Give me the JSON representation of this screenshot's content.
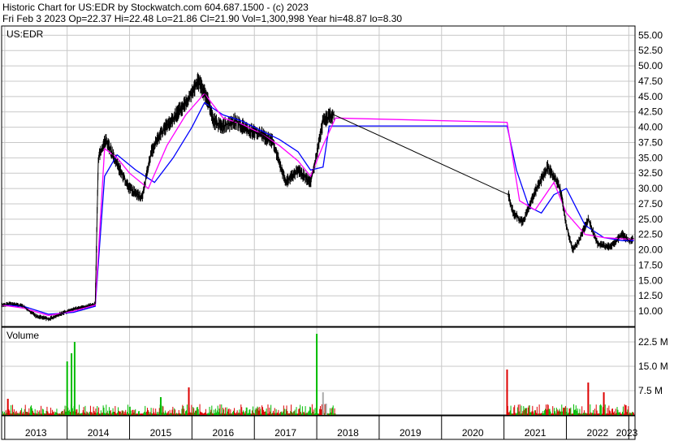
{
  "header": {
    "line1": "Historic Chart for US:EDR by Stockwatch.com 604.687.1500 - (c) 2023",
    "line2": "Fri Feb  3 2023   Op=22.37   Hi=22.48   Lo=21.86   Cl=21.90   Vol=1,300,998   Year hi=48.87   lo=8.30"
  },
  "chart_data": [
    {
      "type": "line",
      "panel": "price",
      "symbol_label": "US:EDR",
      "ylim": [
        7.5,
        56.5
      ],
      "y_ticks": [
        "10.00",
        "12.50",
        "15.00",
        "17.50",
        "20.00",
        "22.50",
        "25.00",
        "27.50",
        "30.00",
        "32.50",
        "35.00",
        "37.50",
        "40.00",
        "42.50",
        "45.00",
        "47.50",
        "50.00",
        "52.50",
        "55.00"
      ],
      "xlim": [
        2012.95,
        2023.1
      ],
      "x_ticks": [
        "2013",
        "2014",
        "2015",
        "2016",
        "2017",
        "2018",
        "2019",
        "2020",
        "2021",
        "2022",
        "2023"
      ],
      "grid": true,
      "series": [
        {
          "color": "#000000",
          "x": [
            2012.95,
            2013.1,
            2013.3,
            2013.5,
            2013.7,
            2013.9,
            2014.1,
            2014.3,
            2014.45,
            2014.5,
            2014.62,
            2014.8,
            2015.0,
            2015.2,
            2015.35,
            2015.5,
            2015.7,
            2015.9,
            2016.1,
            2016.25,
            2016.35,
            2016.5,
            2016.7,
            2016.9,
            2017.1,
            2017.3,
            2017.5,
            2017.7,
            2017.9,
            2018.0,
            2018.1,
            2018.2,
            2018.28,
            2021.07,
            2021.15,
            2021.3,
            2021.5,
            2021.7,
            2021.9,
            2022.0,
            2022.1,
            2022.2,
            2022.35,
            2022.5,
            2022.7,
            2022.9,
            2023.0,
            2023.08
          ],
          "y": [
            11.0,
            11.2,
            10.8,
            9.2,
            8.7,
            9.6,
            10.3,
            10.7,
            11.2,
            35.0,
            38.0,
            34.0,
            30.0,
            28.5,
            36.0,
            39.0,
            41.5,
            44.0,
            47.5,
            44.5,
            41.0,
            40.2,
            41.0,
            39.5,
            39.0,
            37.5,
            31.0,
            33.0,
            31.0,
            35.5,
            41.0,
            41.8,
            42.0,
            29.0,
            26.0,
            24.5,
            29.5,
            33.5,
            30.0,
            24.0,
            20.0,
            21.5,
            25.0,
            21.0,
            20.5,
            22.5,
            21.5,
            21.9
          ]
        },
        {
          "color": "#ff00ff",
          "x": [
            2012.95,
            2013.3,
            2013.7,
            2014.1,
            2014.45,
            2014.6,
            2014.8,
            2015.0,
            2015.3,
            2015.6,
            2015.9,
            2016.2,
            2016.5,
            2016.8,
            2017.1,
            2017.4,
            2017.7,
            2017.9,
            2018.1,
            2018.3,
            2021.05,
            2021.25,
            2021.5,
            2021.8,
            2022.0,
            2022.3,
            2022.6,
            2022.9,
            2023.08
          ],
          "y": [
            11.0,
            10.5,
            9.3,
            10.0,
            11.0,
            36.5,
            35.0,
            32.5,
            30.0,
            37.0,
            42.0,
            45.5,
            41.5,
            40.5,
            39.0,
            37.0,
            34.5,
            32.0,
            37.0,
            41.5,
            40.8,
            28.0,
            26.5,
            31.0,
            26.0,
            22.5,
            22.0,
            21.8,
            21.7
          ]
        },
        {
          "color": "#0000ff",
          "x": [
            2012.95,
            2013.3,
            2013.7,
            2014.1,
            2014.45,
            2014.6,
            2014.8,
            2015.1,
            2015.4,
            2015.7,
            2016.0,
            2016.2,
            2016.5,
            2016.8,
            2017.1,
            2017.4,
            2017.7,
            2017.9,
            2018.1,
            2018.2,
            2021.05,
            2021.2,
            2021.4,
            2021.6,
            2021.8,
            2022.0,
            2022.3,
            2022.6,
            2022.9,
            2023.08
          ],
          "y": [
            11.0,
            10.8,
            9.5,
            9.8,
            10.8,
            32.0,
            35.5,
            33.0,
            31.0,
            35.0,
            40.0,
            44.0,
            42.0,
            41.0,
            39.5,
            38.0,
            36.0,
            33.0,
            33.5,
            40.2,
            40.2,
            33.0,
            27.0,
            26.0,
            29.0,
            30.0,
            24.0,
            22.0,
            21.5,
            21.5
          ]
        }
      ]
    },
    {
      "type": "bar",
      "panel": "volume",
      "title": "Volume",
      "ylim": [
        0,
        27
      ],
      "y_ticks": [
        "7.5 M",
        "15.0 M",
        "22.5 M"
      ],
      "y_tick_values": [
        7.5,
        15.0,
        22.5
      ],
      "grid": true,
      "colors": {
        "up": "#00bb00",
        "down": "#dd0000",
        "neutral": "#aaaaaa"
      },
      "spikes": [
        {
          "x": 2014.0,
          "value": 16.5,
          "color": "green"
        },
        {
          "x": 2014.07,
          "value": 19.0,
          "color": "green"
        },
        {
          "x": 2014.12,
          "value": 22.5,
          "color": "green"
        },
        {
          "x": 2015.5,
          "value": 5.5,
          "color": "green"
        },
        {
          "x": 2015.95,
          "value": 8.5,
          "color": "red"
        },
        {
          "x": 2018.0,
          "value": 25.0,
          "color": "green"
        },
        {
          "x": 2018.1,
          "value": 7.0,
          "color": "neutral"
        },
        {
          "x": 2018.15,
          "value": 3.5,
          "color": "neutral"
        },
        {
          "x": 2013.05,
          "value": 5.0,
          "color": "red"
        },
        {
          "x": 2021.05,
          "value": 14.0,
          "color": "red"
        },
        {
          "x": 2022.35,
          "value": 10.0,
          "color": "red"
        },
        {
          "x": 2022.6,
          "value": 7.0,
          "color": "red"
        }
      ]
    }
  ]
}
